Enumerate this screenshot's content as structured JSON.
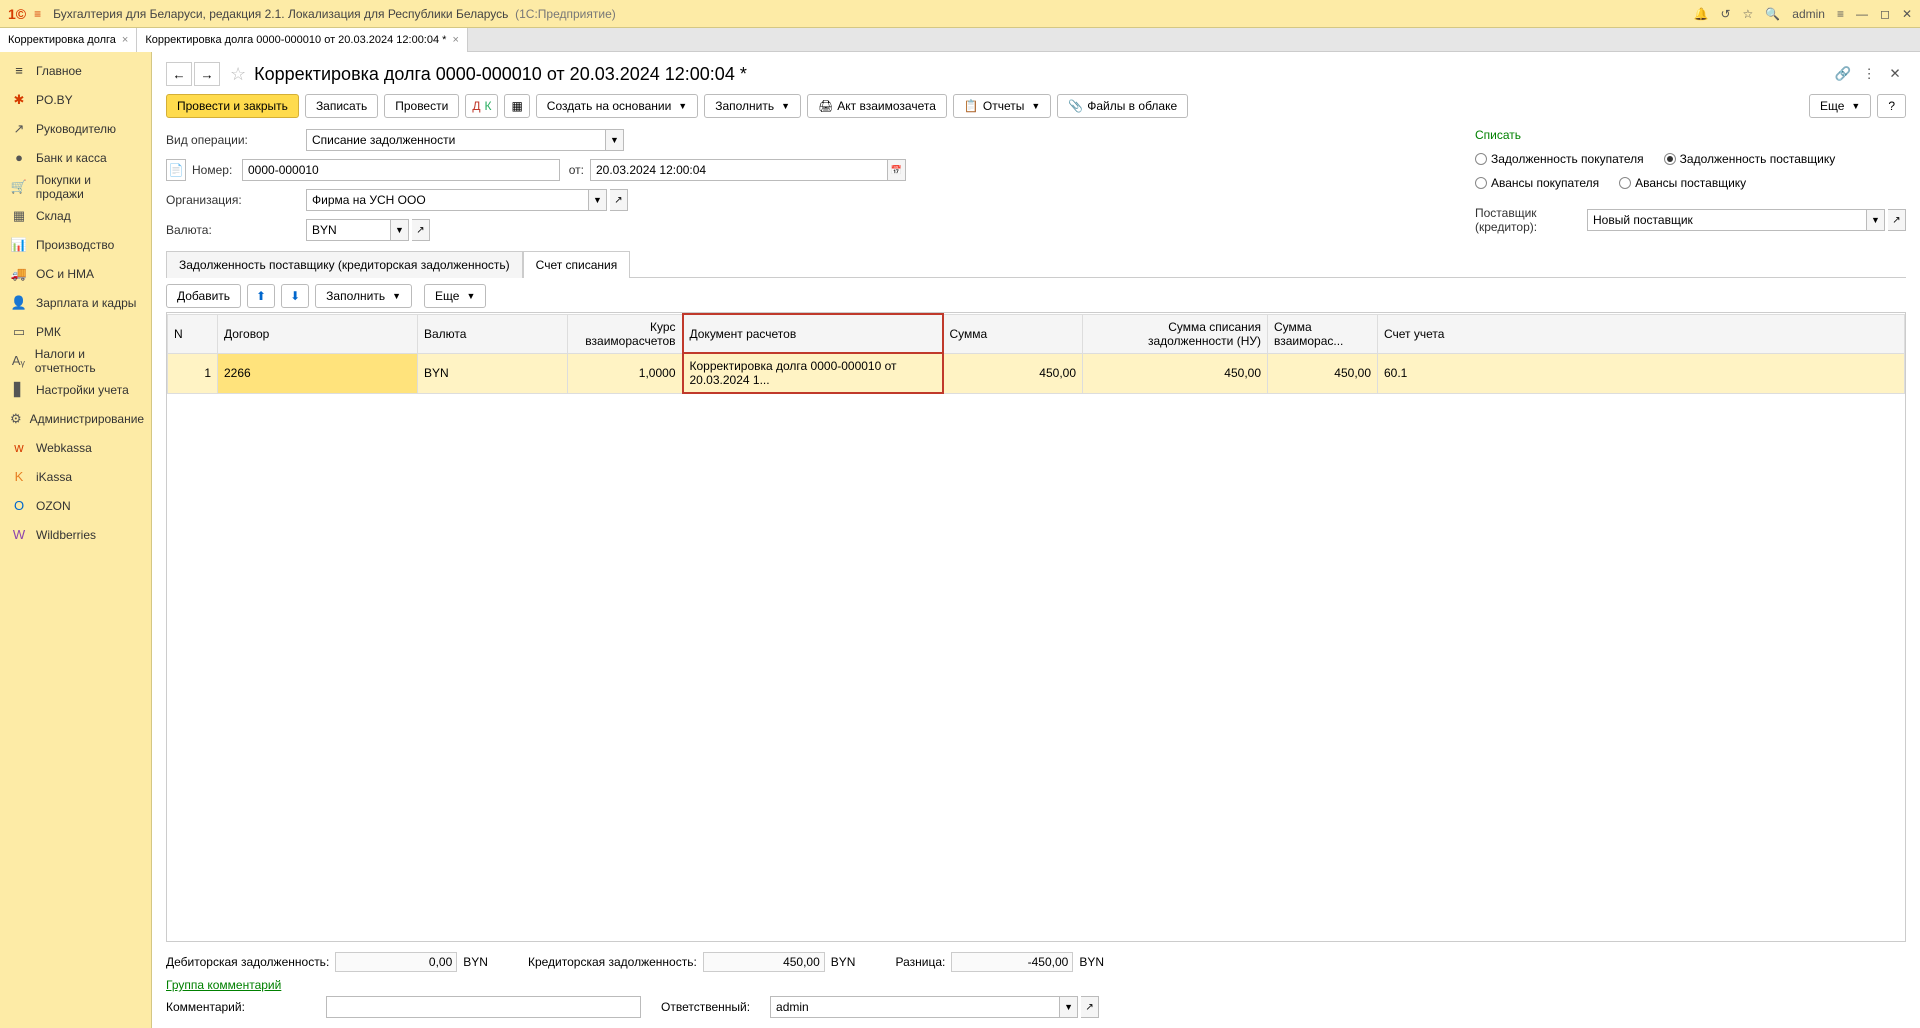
{
  "app_title": "Бухгалтерия для Беларуси, редакция 2.1. Локализация для Республики Беларусь",
  "app_suffix": "(1С:Предприятие)",
  "admin_name": "admin",
  "tabs": [
    {
      "label": "Корректировка долга"
    },
    {
      "label": "Корректировка долга 0000-000010 от 20.03.2024 12:00:04 *"
    }
  ],
  "sidebar": [
    {
      "icon": "≡",
      "label": "Главное",
      "color": "#333"
    },
    {
      "icon": "✱",
      "label": "PO.BY",
      "color": "#d63c00"
    },
    {
      "icon": "↗",
      "label": "Руководителю",
      "color": "#555"
    },
    {
      "icon": "●",
      "label": "Банк и касса",
      "color": "#555"
    },
    {
      "icon": "🛒",
      "label": "Покупки и продажи",
      "color": "#555"
    },
    {
      "icon": "▦",
      "label": "Склад",
      "color": "#555"
    },
    {
      "icon": "📊",
      "label": "Производство",
      "color": "#555"
    },
    {
      "icon": "🚚",
      "label": "ОС и НМА",
      "color": "#555"
    },
    {
      "icon": "👤",
      "label": "Зарплата и кадры",
      "color": "#555"
    },
    {
      "icon": "▭",
      "label": "РМК",
      "color": "#555"
    },
    {
      "icon": "Aᵧ",
      "label": "Налоги и отчетность",
      "color": "#555"
    },
    {
      "icon": "▋",
      "label": "Настройки учета",
      "color": "#555"
    },
    {
      "icon": "⚙",
      "label": "Администрирование",
      "color": "#555"
    },
    {
      "icon": "w",
      "label": "Webkassa",
      "color": "#d63c00"
    },
    {
      "icon": "K",
      "label": "iKassa",
      "color": "#e67e22"
    },
    {
      "icon": "O",
      "label": "OZON",
      "color": "#0066cc"
    },
    {
      "icon": "W",
      "label": "Wildberries",
      "color": "#8e44ad"
    }
  ],
  "page_title": "Корректировка долга 0000-000010 от 20.03.2024 12:00:04 *",
  "toolbar": {
    "post_close": "Провести и закрыть",
    "write": "Записать",
    "post": "Провести",
    "create_based": "Создать на основании",
    "fill": "Заполнить",
    "act": "Акт взаимозачета",
    "reports": "Отчеты",
    "files": "Файлы в облаке",
    "more": "Еще"
  },
  "form": {
    "op_type_label": "Вид операции:",
    "op_type_value": "Списание задолженности",
    "number_label": "Номер:",
    "number_value": "0000-000010",
    "from_label": "от:",
    "date_value": "20.03.2024 12:00:04",
    "org_label": "Организация:",
    "org_value": "Фирма на УСН ООО",
    "currency_label": "Валюта:",
    "currency_value": "BYN"
  },
  "write_off": {
    "title": "Списать",
    "r1": "Задолженность покупателя",
    "r2": "Задолженность поставщику",
    "r3": "Авансы покупателя",
    "r4": "Авансы поставщику"
  },
  "supplier_label": "Поставщик (кредитор):",
  "supplier_value": "Новый поставщик",
  "tabs2": {
    "t1": "Задолженность поставщику (кредиторская задолженность)",
    "t2": "Счет списания"
  },
  "table_toolbar": {
    "add": "Добавить",
    "fill": "Заполнить",
    "more": "Еще"
  },
  "columns": {
    "n": "N",
    "contract": "Договор",
    "currency": "Валюта",
    "rate": "Курс взаиморасчетов",
    "doc": "Документ расчетов",
    "amount": "Сумма",
    "amount_nu": "Сумма списания задолженности (НУ)",
    "amount_vz": "Сумма взаиморас...",
    "account": "Счет учета"
  },
  "rows": [
    {
      "n": "1",
      "contract": "2266",
      "currency": "BYN",
      "rate": "1,0000",
      "doc": "Корректировка долга 0000-000010 от 20.03.2024 1...",
      "amount": "450,00",
      "amount_nu": "450,00",
      "amount_vz": "450,00",
      "account": "60.1"
    }
  ],
  "totals": {
    "debit_label": "Дебиторская задолженность:",
    "debit_val": "0,00",
    "debit_cur": "BYN",
    "credit_label": "Кредиторская задолженность:",
    "credit_val": "450,00",
    "credit_cur": "BYN",
    "diff_label": "Разница:",
    "diff_val": "-450,00",
    "diff_cur": "BYN"
  },
  "comment_link": "Группа комментарий",
  "comment_label": "Комментарий:",
  "responsible_label": "Ответственный:",
  "responsible_value": "admin"
}
